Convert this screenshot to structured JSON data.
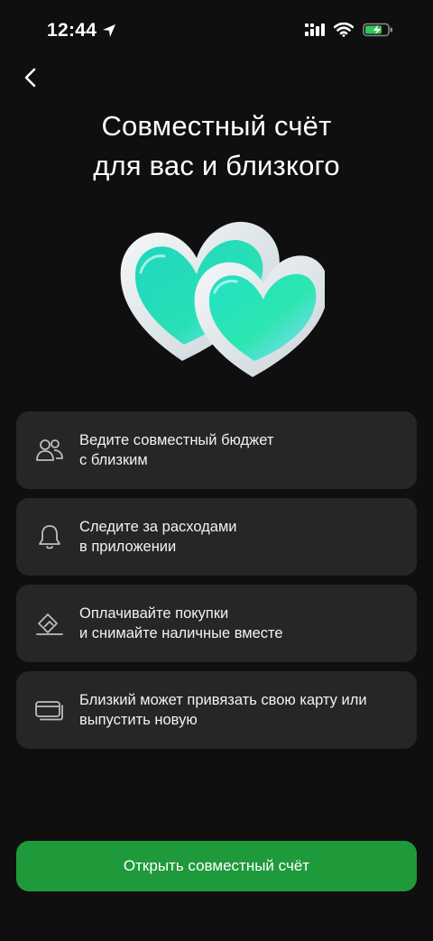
{
  "status_bar": {
    "time": "12:44",
    "icons": [
      "location-arrow-icon",
      "cellular-signal-icon",
      "wifi-icon",
      "battery-charging-icon"
    ]
  },
  "navigation": {
    "back_icon": "chevron-left-icon"
  },
  "header": {
    "title_line1": "Совместный счёт",
    "title_line2": "для вас и близкого"
  },
  "hero": {
    "icon": "two-hearts-icon",
    "colors": {
      "glass": "#e9eef0",
      "heart_fill": "#25d9b8",
      "heart_edge": "#9be8ff"
    }
  },
  "features": [
    {
      "icon": "people-icon",
      "line1": "Ведите совместный бюджет",
      "line2": "с близким"
    },
    {
      "icon": "bell-icon",
      "line1": "Следите за расходами",
      "line2": "в приложении"
    },
    {
      "icon": "wallet-tag-icon",
      "line1": "Оплачивайте покупки",
      "line2": "и снимайте наличные вместе"
    },
    {
      "icon": "cards-icon",
      "line1": "Близкий может привязать свою карту или",
      "line2": "выпустить новую"
    }
  ],
  "action": {
    "label": "Открыть совместный счёт"
  },
  "colors": {
    "background": "#0f0f0f",
    "card": "#262626",
    "accent_green": "#1f9a3b",
    "battery_green": "#34c759"
  }
}
